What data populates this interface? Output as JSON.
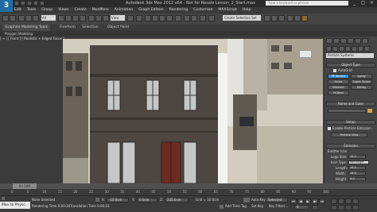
{
  "window": {
    "logo": "3",
    "title": "Autodesk 3ds Max 2012 x64 - Not for Resale  Lesson_2_Start.max",
    "search_placeholder": "Type a keyword or phrase",
    "controls": [
      "_",
      "□",
      "×"
    ]
  },
  "menubar": [
    "Edit",
    "Tools",
    "Group",
    "Views",
    "Create",
    "Modifiers",
    "Animation",
    "Graph Editors",
    "Rendering",
    "Customize",
    "MAXScript",
    "Help"
  ],
  "toolbar": {
    "filter_value": "All",
    "view_dropdown": "View",
    "selection_set": "Create Selection Set"
  },
  "ribbon": {
    "tabs": [
      "Graphite Modeling Tools",
      "Freeform",
      "Selection",
      "Object Paint"
    ],
    "subtitle": "Polygon Modeling"
  },
  "viewport": {
    "label": "[ + ] [ Front ] [ Realistic + Edged Faces ]"
  },
  "command_panel": {
    "category_dropdown": "Particle Systems",
    "object_type": {
      "title": "Object Type",
      "autogrid": "AutoGrid",
      "buttons": [
        "PF Source",
        "Spray",
        "Snow",
        "Super Spray",
        "Blizzard",
        "PArray",
        "PCloud"
      ]
    },
    "name_and_color": "Name and Color",
    "setup": {
      "title": "Setup",
      "enable_label": "Enable Particle Emission",
      "view_button": "Particle View"
    },
    "emission": {
      "title": "Emission",
      "emitter_icon": "Emitter Icon",
      "logo_size_label": "Logo Size:",
      "logo_size_value": "18.0",
      "icon_type_label": "Icon Type:",
      "icon_type_value": "Rectangle",
      "length_label": "Length:",
      "length_value": "18.0",
      "width_label": "Width:",
      "width_value": "18.0",
      "height_label": "Height:",
      "height_value": "0.0",
      "show_label": "Show:",
      "show_logo": "Logo",
      "show_icon": "Icon"
    }
  },
  "timeline": {
    "frame": "0 / 100",
    "ticks": [
      "0",
      "5",
      "10",
      "15",
      "20",
      "25",
      "30",
      "35",
      "40",
      "45",
      "50",
      "55",
      "60",
      "65",
      "70",
      "75",
      "80",
      "85",
      "90",
      "95",
      "100"
    ]
  },
  "status": {
    "maxscript": "Max to Physc.",
    "selection": "None Selected",
    "rendering_time": "Rendering Time  0:00:20",
    "translation_time": "Translation Time  0:00:03",
    "x_label": "X:",
    "x_value": "-10.0cm",
    "y_label": "Y:",
    "y_value": "0.0cm",
    "z_label": "Z:",
    "z_value": "235.0cm",
    "grid": "Grid = 10.0cm",
    "autokey": "Auto Key",
    "selected_option": "Selected",
    "add_time_tag": "Add Time Tag",
    "set_key": "Set Key",
    "key_filters": "Key Filters...",
    "frame_field": "0"
  }
}
